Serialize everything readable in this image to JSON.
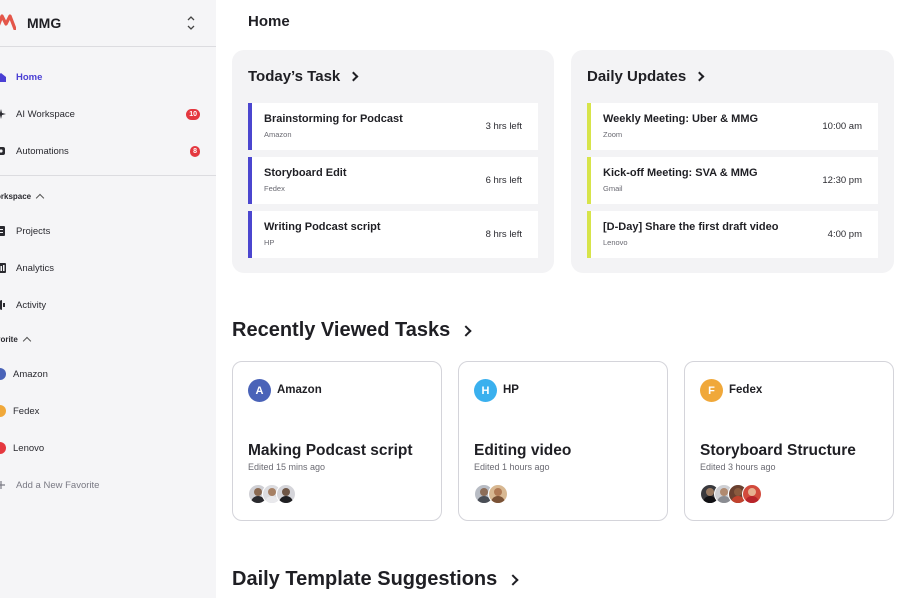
{
  "brand": {
    "name": "MMG",
    "logo_icon": "mmg-logo-icon",
    "switcher_icon": "chevron-up-down-icon",
    "logo_color": "#e4564a"
  },
  "sidebar": {
    "primary": [
      {
        "label": "Home",
        "icon": "home-icon",
        "active": true
      },
      {
        "label": "AI Workspace",
        "icon": "sparkle-icon",
        "badge": "10"
      },
      {
        "label": "Automations",
        "icon": "automation-icon",
        "badge": "8"
      }
    ],
    "workspace_title": "orkspace",
    "workspace": [
      {
        "label": "Projects",
        "icon": "projects-icon"
      },
      {
        "label": "Analytics",
        "icon": "analytics-icon"
      },
      {
        "label": "Activity",
        "icon": "activity-icon"
      }
    ],
    "favorite_title": "vorite",
    "favorites": [
      {
        "label": "Amazon",
        "color": "#4a63b8"
      },
      {
        "label": "Fedex",
        "color": "#f0a83a"
      },
      {
        "label": "Lenovo",
        "color": "#e5383f"
      }
    ],
    "add_favorite": "Add a New Favorite"
  },
  "main": {
    "page_title": "Home",
    "todays_task": {
      "title": "Today’s Task",
      "accent": "#4b46cf",
      "items": [
        {
          "title": "Brainstorming for Podcast",
          "sub": "Amazon",
          "right": "3 hrs left"
        },
        {
          "title": "Storyboard Edit",
          "sub": "Fedex",
          "right": "6 hrs left"
        },
        {
          "title": "Writing Podcast script",
          "sub": "HP",
          "right": "8 hrs left"
        }
      ]
    },
    "daily_updates": {
      "title": "Daily Updates",
      "accent": "#d7e44a",
      "items": [
        {
          "title": "Weekly Meeting: Uber & MMG",
          "sub": "Zoom",
          "right": "10:00 am"
        },
        {
          "title": "Kick-off Meeting: SVA & MMG",
          "sub": "Gmail",
          "right": "12:30 pm"
        },
        {
          "title": "[D-Day] Share the first draft video",
          "sub": "Lenovo",
          "right": "4:00 pm"
        }
      ]
    },
    "recent_title": "Recently Viewed Tasks",
    "recent": [
      {
        "initial": "A",
        "org": "Amazon",
        "color": "#4a63b8",
        "title": "Making Podcast script",
        "edited": "Edited 15 mins ago",
        "people": 3
      },
      {
        "initial": "H",
        "org": "HP",
        "color": "#3ab0ee",
        "title": "Editing video",
        "edited": "Edited 1 hours ago",
        "people": 2
      },
      {
        "initial": "F",
        "org": "Fedex",
        "color": "#f0a83a",
        "title": "Storyboard Structure",
        "edited": "Edited 3 hours ago",
        "people": 4
      }
    ],
    "templates_title": "Daily Template Suggestions"
  }
}
